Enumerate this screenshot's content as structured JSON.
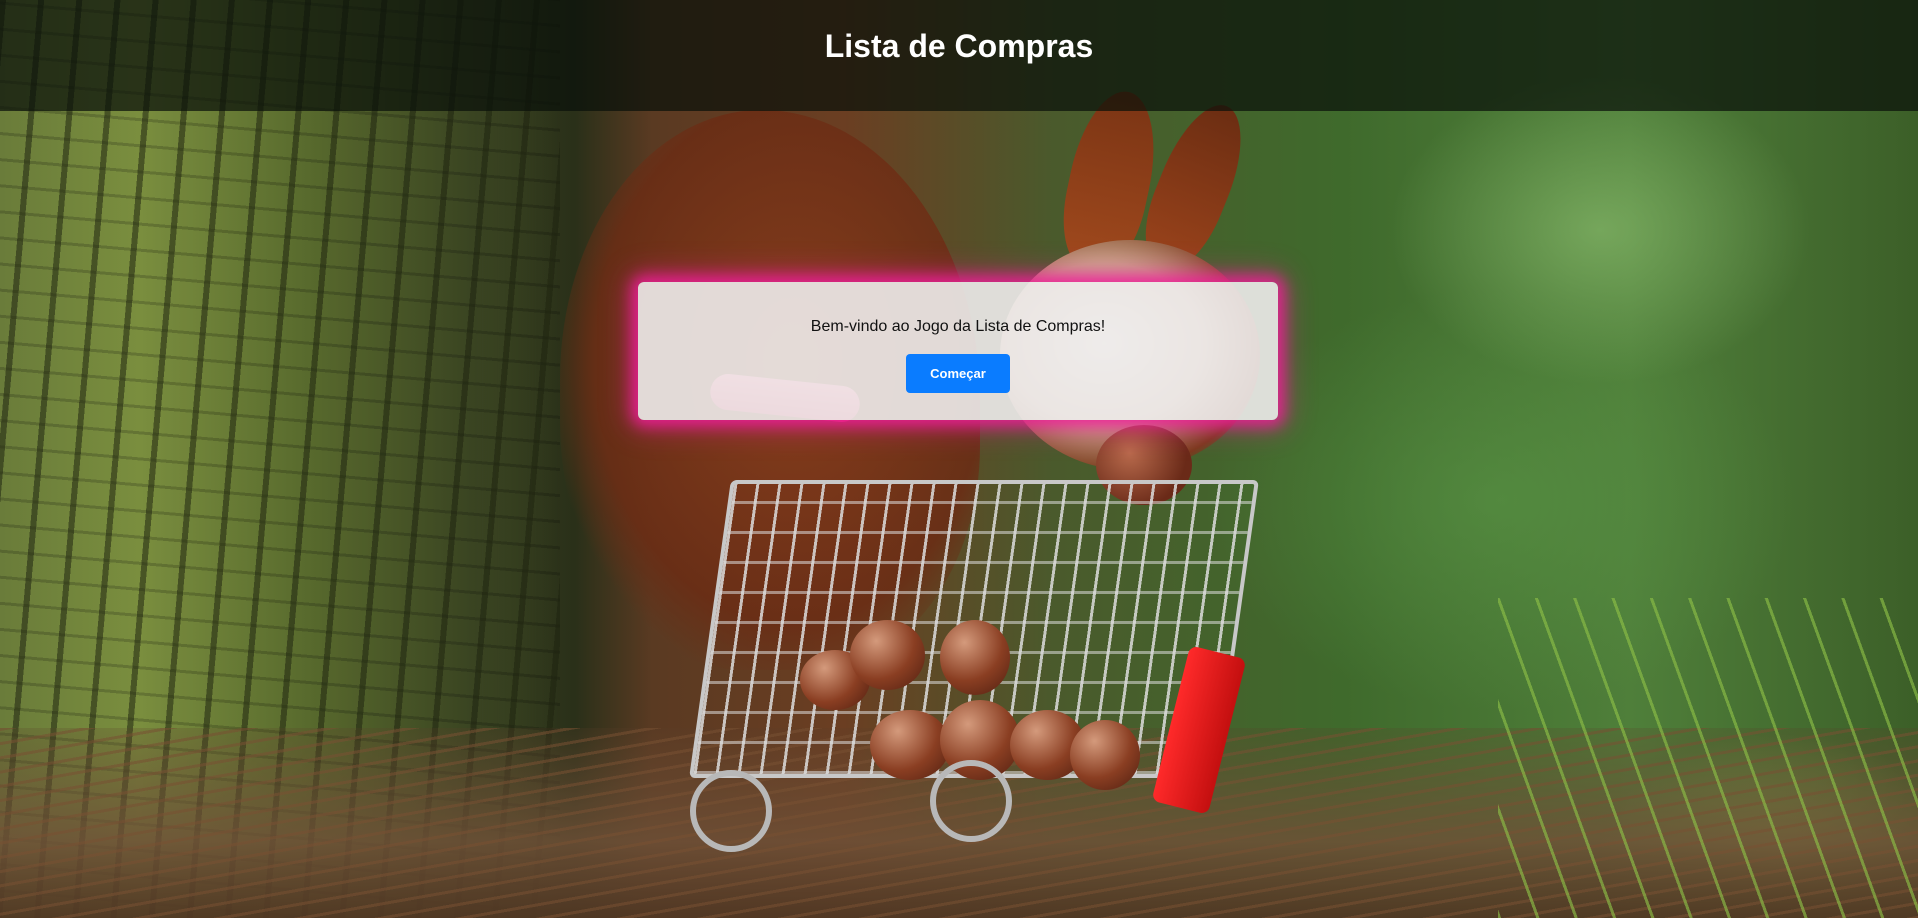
{
  "header": {
    "title": "Lista de Compras"
  },
  "dialog": {
    "message": "Bem-vindo ao Jogo da Lista de Compras!",
    "start_label": "Começar"
  },
  "colors": {
    "header_bg": "#0a100a",
    "dialog_glow": "#ec1e96",
    "button_bg": "#0a7cff"
  },
  "background": {
    "description_icon": "squirrel-with-shopping-cart-photo"
  }
}
